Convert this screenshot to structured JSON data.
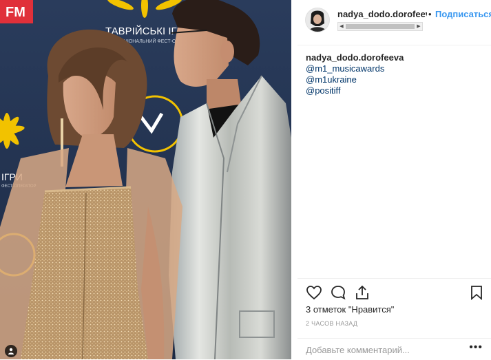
{
  "post": {
    "username": "nadya_dodo.dorofeeva",
    "dot": "•",
    "follow_label": "Подписаться",
    "caption_user": "nadya_dodo.dorofeeva",
    "mentions": [
      "@m1_musicawards",
      "@m1ukraine",
      "@positiff"
    ],
    "likes_text": "3 отметок \"Нравится\"",
    "time_text": "2 часов назад",
    "comment_placeholder": "Добавьте комментарий...",
    "more_label": "•••"
  },
  "photo": {
    "backdrop_text": "ТАВРІЙСЬКІ ІГРИ",
    "backdrop_sub": "НАЦІОНАЛЬНИЙ ФЕСТ-ОПЕНЕР",
    "backdrop_text2": "ІГРИ",
    "backdrop_sub2": "ФЕСТ-ОПЕРАТОР",
    "backdrop_fm": "FM"
  },
  "colors": {
    "link": "#003569",
    "follow": "#3897f0",
    "backdrop": "#22334f",
    "accent_yellow": "#f2c200",
    "accent_red": "#e0303a"
  }
}
